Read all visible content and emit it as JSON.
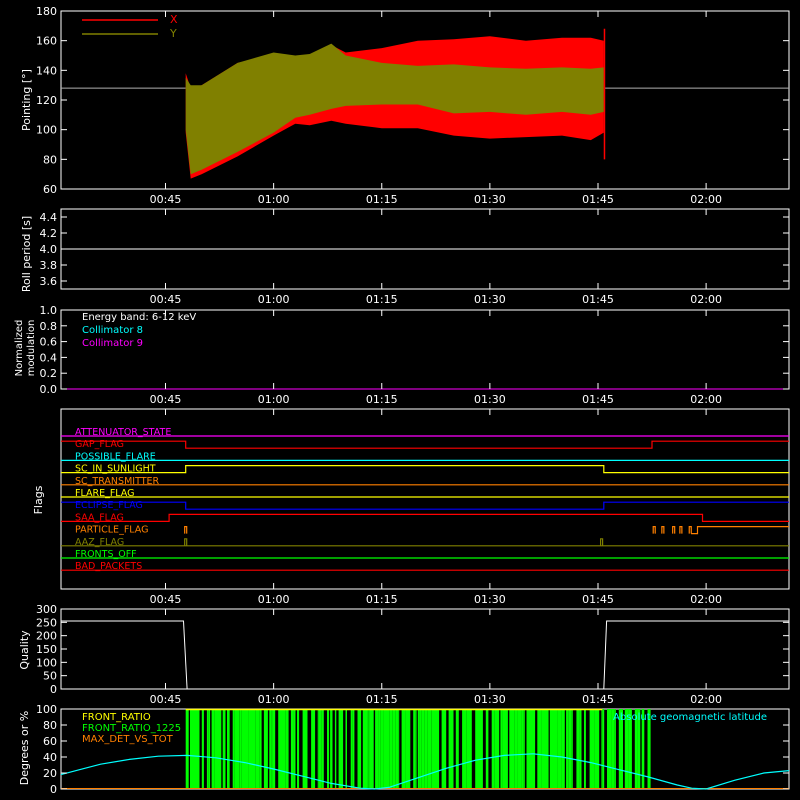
{
  "time_ticks": [
    "00:45",
    "01:00",
    "01:15",
    "01:30",
    "01:45",
    "02:00"
  ],
  "time_tick_minutes": [
    45,
    60,
    75,
    90,
    105,
    120
  ],
  "time_range_minutes": [
    30.5,
    131.5
  ],
  "chart_data": [
    {
      "type": "area",
      "ylabel": "Pointing [°]",
      "ylim": [
        60,
        180
      ],
      "yticks": [
        60,
        80,
        100,
        120,
        140,
        160,
        180
      ],
      "legend_placement": "top-left",
      "series": [
        {
          "name": "X",
          "color": "#ff0000",
          "envelope": {
            "x": [
              47.8,
              48.5,
              50,
              55,
              60,
              63,
              65,
              68,
              70,
              75,
              80,
              85,
              90,
              95,
              100,
              104,
              105.8
            ],
            "max": [
              138,
              128,
              130,
              145,
              150,
              148,
              150,
              157,
              152,
              155,
              160,
              161,
              163,
              160,
              162,
              162,
              160
            ],
            "min": [
              98,
              67,
              70,
              82,
              96,
              104,
              103,
              106,
              104,
              101,
              101,
              96,
              94,
              95,
              96,
              93,
              98
            ]
          }
        },
        {
          "name": "Y",
          "color": "#808000",
          "envelope": {
            "x": [
              47.8,
              48.5,
              50,
              55,
              60,
              63,
              65,
              68,
              70,
              75,
              80,
              85,
              90,
              95,
              100,
              104,
              105.8
            ],
            "max": [
              135,
              130,
              130,
              145,
              152,
              150,
              151,
              158,
              150,
              145,
              143,
              144,
              142,
              141,
              142,
              141,
              142
            ],
            "min": [
              100,
              70,
              73,
              85,
              98,
              108,
              110,
              114,
              116,
              117,
              117,
              111,
              112,
              110,
              112,
              110,
              112
            ]
          }
        }
      ],
      "reference_line": {
        "value": 128,
        "color": "#b0b0b0"
      },
      "spike": {
        "x": 105.9,
        "y_min": 80,
        "y_max": 168
      }
    },
    {
      "type": "line",
      "ylabel": "Roll period [s]",
      "ylim": [
        3.5,
        4.5
      ],
      "yticks": [
        3.6,
        3.8,
        4.0,
        4.2,
        4.4
      ],
      "series": [
        {
          "color": "#ffffff",
          "x": [
            30.5,
            131.5
          ],
          "y": [
            4.0,
            4.0
          ]
        }
      ]
    },
    {
      "type": "line",
      "ylabel": "Normalized modulation",
      "ylabel_lines": [
        "Normalized",
        "modulation"
      ],
      "ylim": [
        0,
        1
      ],
      "yticks": [
        0.0,
        0.2,
        0.4,
        0.6,
        0.8,
        1.0
      ],
      "legend_placement": "top-left",
      "legend": [
        {
          "label": "Energy band: 6-12 keV",
          "color": "#ffffff"
        },
        {
          "label": "Collimator 8",
          "color": "#00ffff"
        },
        {
          "label": "Collimator 9",
          "color": "#ff00ff"
        }
      ],
      "series": [
        {
          "name": "Collimator 9",
          "color": "#ff00ff",
          "x": [
            30.5,
            131.5
          ],
          "y": [
            0,
            0
          ]
        }
      ]
    },
    {
      "type": "line",
      "ylabel": "Flags",
      "flags": [
        {
          "label": "ATTENUATOR_STATE",
          "color": "#ff00ff",
          "steps": []
        },
        {
          "label": "GAP_FLAG",
          "color": "#ff0000",
          "steps": [
            [
              30.5,
              1
            ],
            [
              47.8,
              0
            ],
            [
              112.5,
              1
            ]
          ]
        },
        {
          "label": "POSSIBLE_FLARE",
          "color": "#00ffff",
          "steps": []
        },
        {
          "label": "SC_IN_SUNLIGHT",
          "color": "#ffff00",
          "steps": [
            [
              30.5,
              0
            ],
            [
              47.8,
              1
            ],
            [
              105.8,
              0
            ]
          ]
        },
        {
          "label": "SC_TRANSMITTER",
          "color": "#ff8000",
          "steps": []
        },
        {
          "label": "FLARE_FLAG",
          "color": "#ffff00",
          "steps": []
        },
        {
          "label": "ECLIPSE_FLAG",
          "color": "#0000ff",
          "steps": [
            [
              30.5,
              1
            ],
            [
              47.8,
              0
            ],
            [
              105.8,
              1
            ]
          ]
        },
        {
          "label": "SAA_FLAG",
          "color": "#ff0000",
          "steps": [
            [
              30.5,
              0
            ],
            [
              45.5,
              1
            ],
            [
              119.5,
              0
            ]
          ]
        },
        {
          "label": "PARTICLE_FLAG",
          "color": "#ff8000",
          "pulses": [
            47.8,
            112.8,
            114.0,
            115.5,
            116.5,
            117.8
          ],
          "steps": [
            [
              117.9,
              0
            ],
            [
              118.8,
              1
            ]
          ]
        },
        {
          "label": "AAZ_FLAG",
          "color": "#808000",
          "pulses": [
            47.8,
            105.5
          ]
        },
        {
          "label": "FRONTS_OFF",
          "color": "#00ff00",
          "steps": []
        },
        {
          "label": "BAD_PACKETS",
          "color": "#ff0000",
          "steps": []
        }
      ]
    },
    {
      "type": "line",
      "ylabel": "Quality",
      "ylim": [
        0,
        300
      ],
      "yticks": [
        0,
        50,
        100,
        150,
        200,
        250,
        300
      ],
      "series": [
        {
          "color": "#ffffff",
          "x": [
            30.5,
            47.5,
            48.0,
            105.8,
            106.2,
            131.5
          ],
          "y": [
            255,
            255,
            0,
            0,
            255,
            255
          ]
        }
      ]
    },
    {
      "type": "line",
      "ylabel": "Degrees or %",
      "ylim": [
        0,
        100
      ],
      "yticks": [
        0,
        20,
        40,
        60,
        80,
        100
      ],
      "legend_placement": "top-left",
      "legend": [
        {
          "label": "FRONT_RATIO",
          "color": "#ffff00"
        },
        {
          "label": "FRONT_RATIO_1225",
          "color": "#00ff00"
        },
        {
          "label": "MAX_DET_VS_TOT",
          "color": "#ff8000"
        }
      ],
      "right_label": {
        "label": "Absolute geomagnetic latitude",
        "color": "#00ffff"
      },
      "geomag_latitude": {
        "x": [
          30.5,
          33,
          36,
          40,
          44,
          48,
          52,
          56,
          60,
          64,
          68,
          72,
          74,
          76,
          80,
          84,
          88,
          92,
          96,
          100,
          104,
          108,
          112,
          116,
          118,
          120,
          124,
          128,
          131.5
        ],
        "y": [
          18,
          24,
          31,
          37,
          41,
          42,
          39,
          33,
          25,
          16,
          7,
          1,
          0,
          2,
          14,
          26,
          36,
          42,
          44,
          40,
          33,
          24,
          15,
          5,
          1,
          0,
          11,
          20,
          23
        ]
      },
      "front_ratio_1225_band": {
        "x_start": 47.8,
        "x_end": 112.3,
        "value": 100,
        "color": "#00ff00"
      },
      "front_ratio_top": {
        "x_start": 47.8,
        "x_end": 105.6,
        "value": 100,
        "color": "#ffff00"
      }
    }
  ]
}
